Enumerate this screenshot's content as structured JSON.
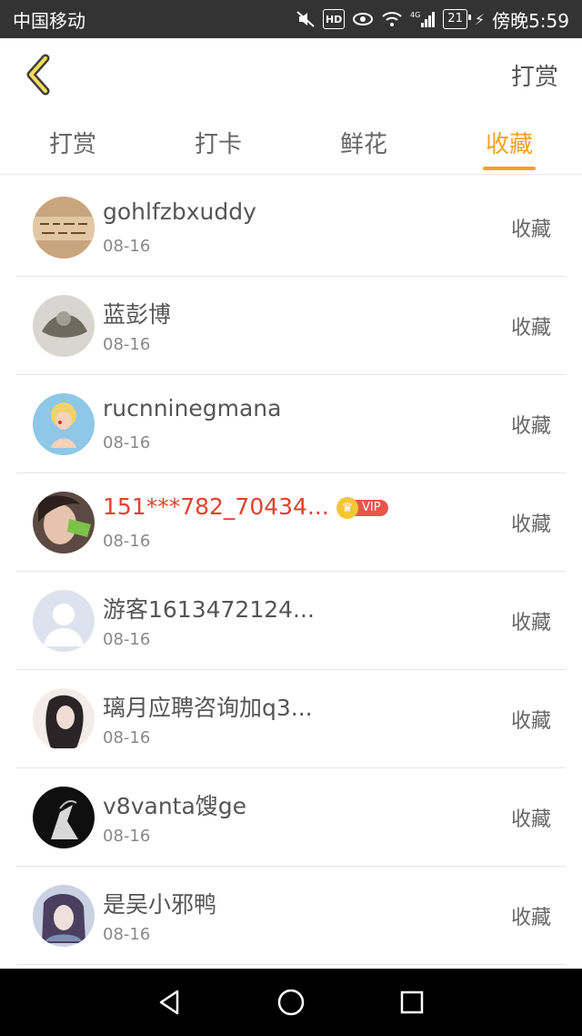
{
  "status": {
    "carrier": "中国移动",
    "battery": "21",
    "time": "傍晚5:59",
    "network": "4G"
  },
  "header": {
    "title": "打赏"
  },
  "tabs": [
    {
      "label": "打赏"
    },
    {
      "label": "打卡"
    },
    {
      "label": "鲜花"
    },
    {
      "label": "收藏"
    }
  ],
  "active_tab_index": 3,
  "vip_label": "VIP",
  "items": [
    {
      "name": "gohlfzbxuddy",
      "date": "08-16",
      "action": "收藏"
    },
    {
      "name": "蓝彭博",
      "date": "08-16",
      "action": "收藏"
    },
    {
      "name": "rucnninegmana",
      "date": "08-16",
      "action": "收藏"
    },
    {
      "name": "151***782_70434...",
      "date": "08-16",
      "action": "收藏"
    },
    {
      "name": "游客1613472124...",
      "date": "08-16",
      "action": "收藏"
    },
    {
      "name": "璃月应聘咨询加q3...",
      "date": "08-16",
      "action": "收藏"
    },
    {
      "name": "v8vanta馊ge",
      "date": "08-16",
      "action": "收藏"
    },
    {
      "name": "是吴小邪鸭",
      "date": "08-16",
      "action": "收藏"
    }
  ],
  "colors": {
    "accent": "#f0a321",
    "vip_name": "#e2412e"
  }
}
